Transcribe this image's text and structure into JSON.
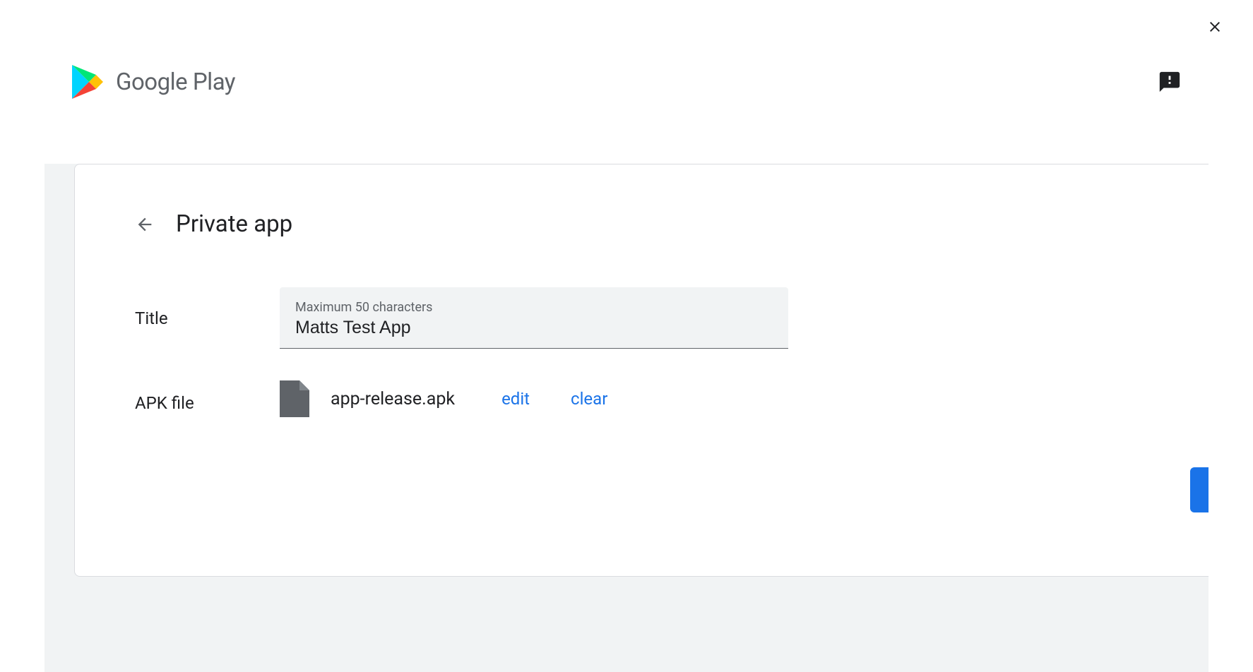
{
  "header": {
    "logo_text": "Google Play"
  },
  "page": {
    "title": "Private app"
  },
  "form": {
    "title": {
      "label": "Title",
      "helper": "Maximum 50 characters",
      "value": "Matts Test App"
    },
    "apk": {
      "label": "APK file",
      "filename": "app-release.apk",
      "edit_label": "edit",
      "clear_label": "clear"
    }
  }
}
